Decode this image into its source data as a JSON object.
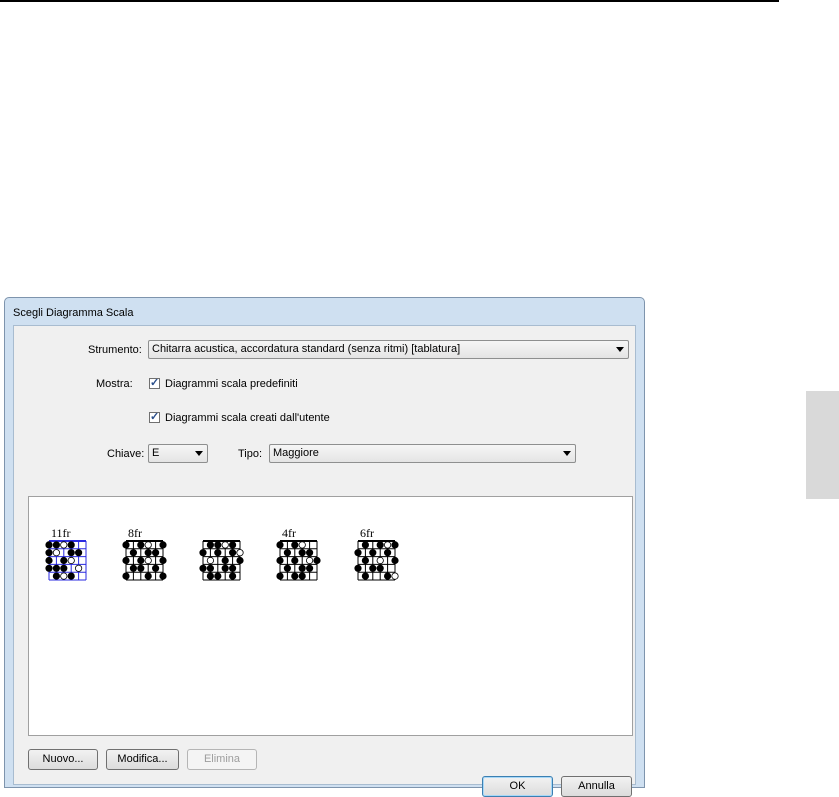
{
  "dialog": {
    "title": "Scegli Diagramma Scala",
    "strumento_label": "Strumento:",
    "strumento_value": "Chitarra acustica, accordatura standard (senza ritmi) [tablatura]",
    "mostra_label": "Mostra:",
    "checkbox_predefiniti": {
      "label": "Diagrammi scala predefiniti",
      "checked": true
    },
    "checkbox_utente": {
      "label": "Diagrammi scala creati dall'utente",
      "checked": true
    },
    "chiave_label": "Chiave:",
    "chiave_value": "E",
    "tipo_label": "Tipo:",
    "tipo_value": "Maggiore",
    "diagrams": [
      {
        "fret_label": "11fr",
        "selected": true
      },
      {
        "fret_label": "8fr",
        "selected": false
      },
      {
        "fret_label": "",
        "selected": false
      },
      {
        "fret_label": "4fr",
        "selected": false
      },
      {
        "fret_label": "6fr",
        "selected": false
      }
    ],
    "buttons": {
      "nuovo": "Nuovo...",
      "modifica": "Modifica...",
      "elimina": "Elimina",
      "ok": "OK",
      "annulla": "Annulla"
    }
  },
  "colors": {
    "selected": "#2a2ae0",
    "frame": "#cfe0f1"
  }
}
